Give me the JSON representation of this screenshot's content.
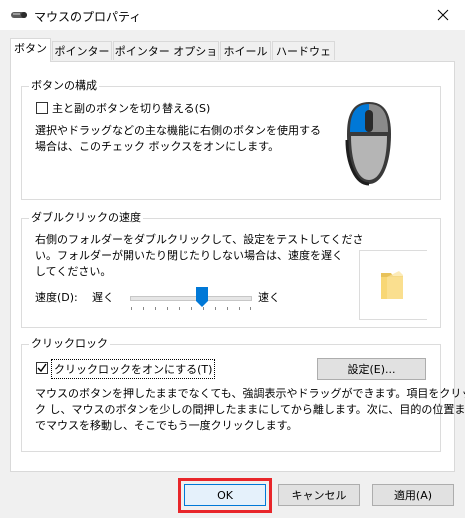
{
  "window": {
    "title": "マウスのプロパティ"
  },
  "tabs": [
    "ボタン",
    "ポインター",
    "ポインター オプション",
    "ホイール",
    "ハードウェア"
  ],
  "button_config": {
    "group_label": "ボタンの構成",
    "switch_label": "主と副のボタンを切り替える(S)",
    "description_line1": "選択やドラッグなどの主な機能に右側のボタンを使用する",
    "description_line2": "場合は、このチェック ボックスをオンにします。",
    "switch_checked": false
  },
  "double_click": {
    "group_label": "ダブルクリックの速度",
    "description_line1": "右側のフォルダーをダブルクリックして、設定をテストしてくださ",
    "description_line2": "い。フォルダーが開いたり閉じたりしない場合は、速度を遅く",
    "description_line3": "してください。",
    "speed_label": "速度(D):",
    "slow_label": "遅く",
    "fast_label": "速く",
    "speed_level": 0.6
  },
  "click_lock": {
    "group_label": "クリックロック",
    "enable_label": "クリックロックをオンにする(T)",
    "enabled": true,
    "settings_button": "設定(E)...",
    "description_line1": "マウスのボタンを押したままでなくても、強調表示やドラッグができます。項目をクリッ",
    "description_line2": "ク し、マウスのボタンを少しの間押したままにしてから離します。次に、目的の位置ま",
    "description_line3": "でマウスを移動し、そこでもう一度クリックします。"
  },
  "footer": {
    "ok": "OK",
    "cancel": "キャンセル",
    "apply": "適用(A)"
  },
  "colors": {
    "accent_blue": "#0078d7",
    "highlight_red": "#e8262a"
  }
}
